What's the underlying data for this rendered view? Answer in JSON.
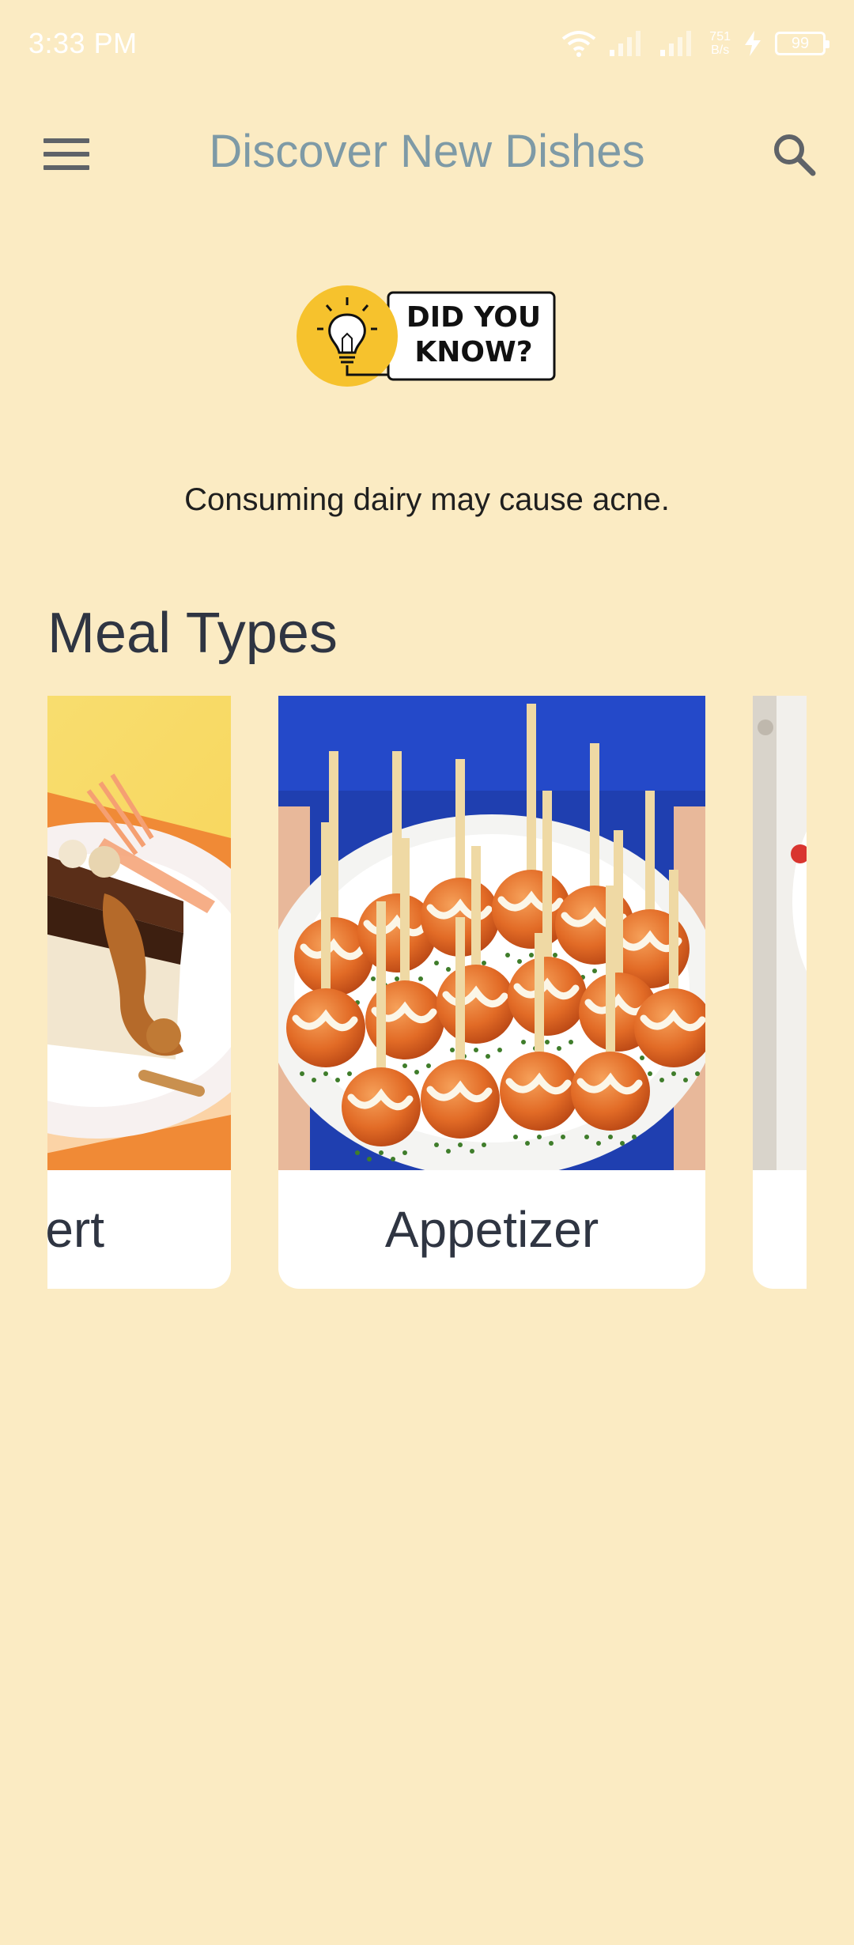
{
  "status_bar": {
    "time": "3:33 PM",
    "net_speed_value": "751",
    "net_speed_unit": "B/s",
    "battery": "99"
  },
  "app_bar": {
    "title": "Discover New Dishes",
    "menu_icon": "menu-icon",
    "search_icon": "search-icon"
  },
  "did_you_know": {
    "line1": "DID YOU",
    "line2": "KNOW?"
  },
  "fact": "Consuming dairy may cause acne.",
  "meal_types": {
    "title": "Meal Types",
    "cards": [
      {
        "label": "ert"
      },
      {
        "label": "Appetizer"
      },
      {
        "label": ""
      }
    ]
  },
  "colors": {
    "background": "#fbebc3",
    "title": "#7e9aa6",
    "text": "#2f3542",
    "badge_yellow": "#f6c22d"
  }
}
